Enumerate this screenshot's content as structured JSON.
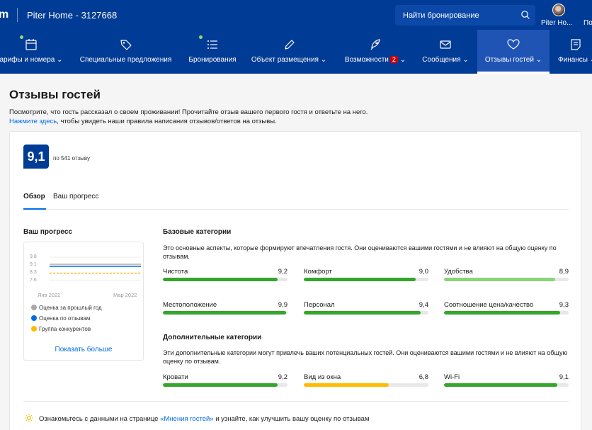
{
  "header": {
    "brand": "m",
    "hotel": "Piter Home - 3127668",
    "search_placeholder": "Найти бронирование",
    "account_name": "Piter Ho...",
    "account_more": "По"
  },
  "nav": [
    {
      "label": "арифы и номера ⌄",
      "icon": "calendar-icon"
    },
    {
      "label": "Специальные предложения",
      "icon": "tag-icon"
    },
    {
      "label": "Бронирования",
      "icon": "list-icon"
    },
    {
      "label": "Объект размещения ⌄",
      "icon": "pencil-icon"
    },
    {
      "label": "Возможности",
      "badge": "2",
      "suffix": "⌄",
      "icon": "rocket-icon"
    },
    {
      "label": "Сообщения ⌄",
      "icon": "envelope-icon"
    },
    {
      "label": "Отзывы гостей ⌄",
      "icon": "heart-icon"
    },
    {
      "label": "Финансы ⌄",
      "icon": "document-icon"
    }
  ],
  "page": {
    "title": "Отзывы гостей",
    "intro_line1": "Посмотрите, что гость рассказал о своем проживании! Прочитайте отзыв вашего первого гостя и ответьте на него.",
    "intro_link": "Нажмите здесь",
    "intro_line2": ", чтобы увидеть наши правила написания отзывов/ответов на отзывы."
  },
  "summary": {
    "score": "9,1",
    "count": "по 541 отзыву"
  },
  "tabs": {
    "overview": "Обзор",
    "progress": "Ваш прогресс"
  },
  "progress": {
    "title": "Ваш прогресс",
    "y_ticks": [
      "9.8",
      "9.1",
      "8.3",
      "7.6"
    ],
    "x_ticks": [
      "Янв 2022",
      "Мар 2022"
    ],
    "legend": [
      {
        "label": "Оценка за прошлый год",
        "color": "#a8a8a8"
      },
      {
        "label": "Оценка по отзывам",
        "color": "#006ce4"
      },
      {
        "label": "Группа конкурентов",
        "color": "#febb02"
      }
    ],
    "show_more": "Показать больше"
  },
  "base_categories": {
    "title": "Базовые категории",
    "description": "Это основные аспекты, которые формируют впечатления гостя. Они оцениваются вашими гостями и не влияют на общую оценку по отзывам.",
    "items": [
      {
        "name": "Чистота",
        "value": "9,2",
        "score": 9.2,
        "color": "#34a62b"
      },
      {
        "name": "Комфорт",
        "value": "9,0",
        "score": 9.0,
        "color": "#34a62b"
      },
      {
        "name": "Удобства",
        "value": "8,9",
        "score": 8.9,
        "color": "#8ad47a"
      },
      {
        "name": "Местоположение",
        "value": "9,9",
        "score": 9.9,
        "color": "#34a62b"
      },
      {
        "name": "Персонал",
        "value": "9,4",
        "score": 9.4,
        "color": "#34a62b"
      },
      {
        "name": "Соотношение цена/качество",
        "value": "9,3",
        "score": 9.3,
        "color": "#34a62b"
      }
    ]
  },
  "extra_categories": {
    "title": "Дополнительные категории",
    "description": "Эти дополнительные категории могут привлечь ваших потенциальных гостей. Они оцениваются вашими гостями и не влияют на общую оценку по отзывам.",
    "items": [
      {
        "name": "Кровати",
        "value": "9,2",
        "score": 9.2,
        "color": "#34a62b"
      },
      {
        "name": "Вид из окна",
        "value": "6,8",
        "score": 6.8,
        "color": "#febb02"
      },
      {
        "name": "Wi-Fi",
        "value": "9,1",
        "score": 9.1,
        "color": "#34a62b"
      }
    ]
  },
  "tip": {
    "before": "Ознакомьтесь с данными на странице ",
    "link": "«Мнения гостей»",
    "after": " и узнайте, как улучшить вашу оценку по отзывам"
  }
}
